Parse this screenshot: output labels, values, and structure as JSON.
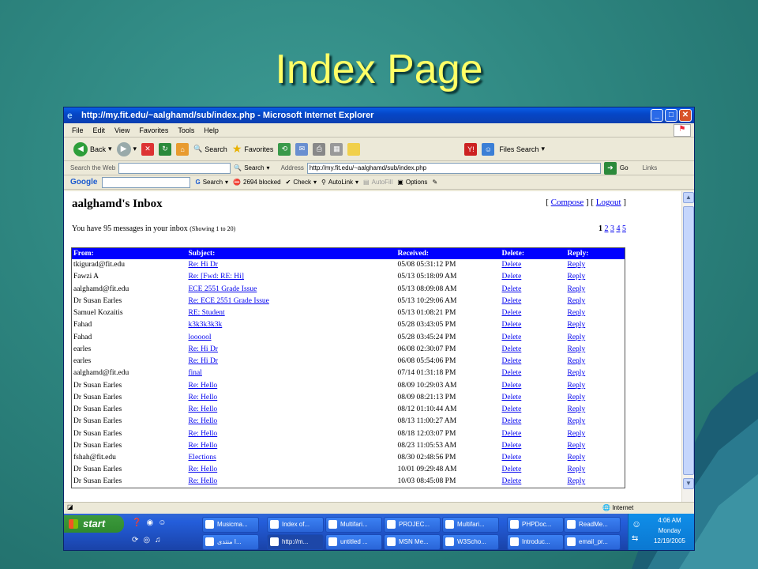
{
  "slide": {
    "title": "Index Page"
  },
  "browser": {
    "window_title": "http://my.fit.edu/~aalghamd/sub/index.php - Microsoft Internet Explorer",
    "menu": [
      "File",
      "Edit",
      "View",
      "Favorites",
      "Tools",
      "Help"
    ],
    "toolbar": {
      "back": "Back",
      "search": "Search",
      "favorites": "Favorites",
      "files_search": "Files Search"
    },
    "searchbar": {
      "label": "Search the Web",
      "search_btn": "Search",
      "address_label": "Address",
      "address": "http://my.fit.edu/~aalghamd/sub/index.php",
      "go": "Go",
      "links": "Links"
    },
    "googlebar": {
      "brand": "Google",
      "search": "Search",
      "blocked": "2694 blocked",
      "check": "Check",
      "autolink": "AutoLink",
      "autofill": "AutoFill",
      "options": "Options"
    },
    "status": {
      "zone": "Internet"
    }
  },
  "inbox": {
    "title": "aalghamd's Inbox",
    "compose": "Compose",
    "logout": "Logout",
    "summary": "You have 95 messages in your inbox",
    "showing": "(Showing 1 to 20)",
    "pages": {
      "current": "1",
      "others": [
        "2",
        "3",
        "4",
        "5"
      ]
    },
    "columns": [
      "From:",
      "Subject:",
      "Received:",
      "Delete:",
      "Reply:"
    ],
    "rows": [
      {
        "from": "tkigurad@fit.edu",
        "subject": "Re: Hi Dr",
        "received": "05/08 05:31:12 PM"
      },
      {
        "from": "Fawzi A",
        "subject": "Re: [Fwd: RE: Hi]",
        "received": "05/13 05:18:09 AM"
      },
      {
        "from": "aalghamd@fit.edu",
        "subject": "ECE 2551 Grade Issue",
        "received": "05/13 08:09:08 AM"
      },
      {
        "from": "Dr Susan Earles",
        "subject": "Re: ECE 2551 Grade Issue",
        "received": "05/13 10:29:06 AM"
      },
      {
        "from": "Samuel Kozaitis",
        "subject": "RE: Student",
        "received": "05/13 01:08:21 PM"
      },
      {
        "from": "Fahad",
        "subject": "k3k3k3k3k",
        "received": "05/28 03:43:05 PM"
      },
      {
        "from": "Fahad",
        "subject": "loooool",
        "received": "05/28 03:45:24 PM"
      },
      {
        "from": "earles",
        "subject": "Re: Hi Dr",
        "received": "06/08 02:30:07 PM"
      },
      {
        "from": "earles",
        "subject": "Re: Hi Dr",
        "received": "06/08 05:54:06 PM"
      },
      {
        "from": "aalghamd@fit.edu",
        "subject": "final",
        "received": "07/14 01:31:18 PM"
      },
      {
        "from": "Dr Susan Earles",
        "subject": "Re: Hello",
        "received": "08/09 10:29:03 AM"
      },
      {
        "from": "Dr Susan Earles",
        "subject": "Re: Hello",
        "received": "08/09 08:21:13 PM"
      },
      {
        "from": "Dr Susan Earles",
        "subject": "Re: Hello",
        "received": "08/12 01:10:44 AM"
      },
      {
        "from": "Dr Susan Earles",
        "subject": "Re: Hello",
        "received": "08/13 11:00:27 AM"
      },
      {
        "from": "Dr Susan Earles",
        "subject": "Re: Hello",
        "received": "08/18 12:03:07 PM"
      },
      {
        "from": "Dr Susan Earles",
        "subject": "Re: Hello",
        "received": "08/23 11:05:53 AM"
      },
      {
        "from": "fshah@fit.edu",
        "subject": "Elections",
        "received": "08/30 02:48:56 PM"
      },
      {
        "from": "Dr Susan Earles",
        "subject": "Re: Hello",
        "received": "10/01 09:29:48 AM"
      },
      {
        "from": "Dr Susan Earles",
        "subject": "Re: Hello",
        "received": "10/03 08:45:08 PM"
      }
    ],
    "delete_label": "Delete",
    "reply_label": "Reply"
  },
  "taskbar": {
    "start": "start",
    "row1": [
      "Musicma...",
      "Index of...",
      "Multifari...",
      "PROJEC...",
      "Multifari...",
      "PHPDoc...",
      "ReadMe..."
    ],
    "row2": [
      "منتدى I...",
      "http://m...",
      "untitled ...",
      "MSN Me...",
      "W3Scho...",
      "Introduc...",
      "email_pr..."
    ],
    "clock": {
      "time": "4:06 AM",
      "day": "Monday",
      "date": "12/19/2005"
    }
  }
}
